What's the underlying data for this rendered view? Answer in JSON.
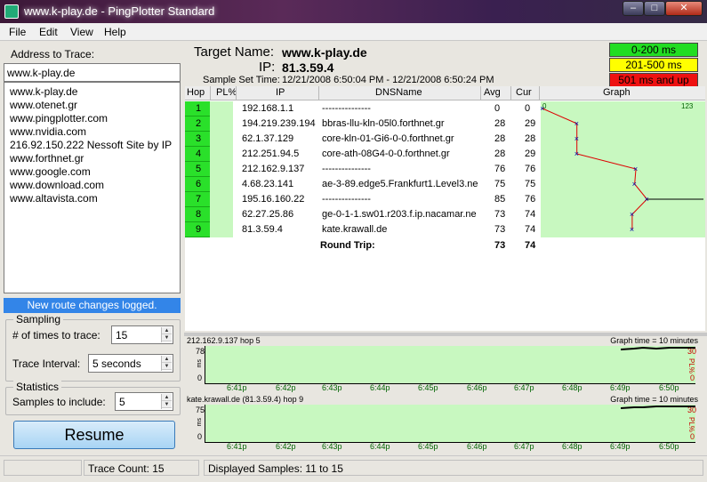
{
  "window": {
    "title": "www.k-play.de - PingPlotter Standard",
    "controls": {
      "min": "–",
      "max": "□",
      "close": "✕"
    }
  },
  "menu": [
    "File",
    "Edit",
    "View",
    "Help"
  ],
  "left": {
    "address_label": "Address to Trace:",
    "address_value": "www.k-play.de",
    "history": [
      "www.k-play.de",
      "www.otenet.gr",
      "www.pingplotter.com",
      "www.nvidia.com",
      "216.92.150.222 Nessoft Site by IP",
      "www.forthnet.gr",
      "www.google.com",
      "www.download.com",
      "www.altavista.com"
    ],
    "route_message": "New route changes logged.",
    "sampling": {
      "title": "Sampling",
      "times_label": "# of times to trace:",
      "times_value": "15",
      "interval_label": "Trace Interval:",
      "interval_value": "5 seconds"
    },
    "statistics": {
      "title": "Statistics",
      "samples_label": "Samples to include:",
      "samples_value": "5"
    },
    "resume_label": "Resume"
  },
  "target": {
    "name_label": "Target Name:",
    "name_value": "www.k-play.de",
    "ip_label": "IP:",
    "ip_value": "81.3.59.4",
    "sample_label": "Sample Set Time:",
    "sample_value": "12/21/2008 6:50:04 PM - 12/21/2008 6:50:24 PM"
  },
  "legend": [
    {
      "label": "0-200 ms",
      "color": "#22dd22",
      "text_color": "#000000"
    },
    {
      "label": "201-500 ms",
      "color": "#ffff00",
      "text_color": "#000000"
    },
    {
      "label": "501 ms and up",
      "color": "#ee1111",
      "text_color": "#000000"
    }
  ],
  "table": {
    "headers": {
      "hop": "Hop",
      "pl": "PL%",
      "ip": "IP",
      "dns": "DNSName",
      "avg": "Avg",
      "cur": "Cur",
      "graph": "Graph"
    },
    "graph_scale_left": "0",
    "graph_scale_right": "123",
    "rows": [
      {
        "hop": "1",
        "ip": "192.168.1.1",
        "dns": "---------------",
        "avg": "0",
        "cur": "0"
      },
      {
        "hop": "2",
        "ip": "194.219.239.194",
        "dns": "bbras-llu-kln-05l0.forthnet.gr",
        "avg": "28",
        "cur": "29"
      },
      {
        "hop": "3",
        "ip": "62.1.37.129",
        "dns": "core-kln-01-Gi6-0-0.forthnet.gr",
        "avg": "28",
        "cur": "28"
      },
      {
        "hop": "4",
        "ip": "212.251.94.5",
        "dns": "core-ath-08G4-0-0.forthnet.gr",
        "avg": "28",
        "cur": "29"
      },
      {
        "hop": "5",
        "ip": "212.162.9.137",
        "dns": "---------------",
        "avg": "76",
        "cur": "76"
      },
      {
        "hop": "6",
        "ip": "4.68.23.141",
        "dns": "ae-3-89.edge5.Frankfurt1.Level3.ne",
        "avg": "75",
        "cur": "75"
      },
      {
        "hop": "7",
        "ip": "195.16.160.22",
        "dns": "---------------",
        "avg": "85",
        "cur": "76"
      },
      {
        "hop": "8",
        "ip": "62.27.25.86",
        "dns": "ge-0-1-1.sw01.r203.f.ip.nacamar.ne",
        "avg": "73",
        "cur": "74"
      },
      {
        "hop": "9",
        "ip": "81.3.59.4",
        "dns": "kate.krawall.de",
        "avg": "73",
        "cur": "74"
      }
    ],
    "round_trip": {
      "label": "Round Trip:",
      "avg": "73",
      "cur": "74"
    }
  },
  "timegraphs": [
    {
      "title": "212.162.9.137 hop 5",
      "time_label": "Graph time = 10 minutes",
      "y_top": "78",
      "y_bottom": "0",
      "y_unit": "ms",
      "pl_top": "30",
      "pl_unit": "PL%",
      "pl_bottom": "0"
    },
    {
      "title": "kate.krawall.de (81.3.59.4) hop 9",
      "time_label": "Graph time = 10 minutes",
      "y_top": "75",
      "y_bottom": "0",
      "y_unit": "ms",
      "pl_top": "30",
      "pl_unit": "PL%",
      "pl_bottom": "0"
    }
  ],
  "time_ticks": [
    "6:41p",
    "6:42p",
    "6:43p",
    "6:44p",
    "6:45p",
    "6:46p",
    "6:47p",
    "6:48p",
    "6:49p",
    "6:50p"
  ],
  "status": {
    "trace_count": "Trace Count: 15",
    "displayed": "Displayed Samples: 11 to 15"
  }
}
